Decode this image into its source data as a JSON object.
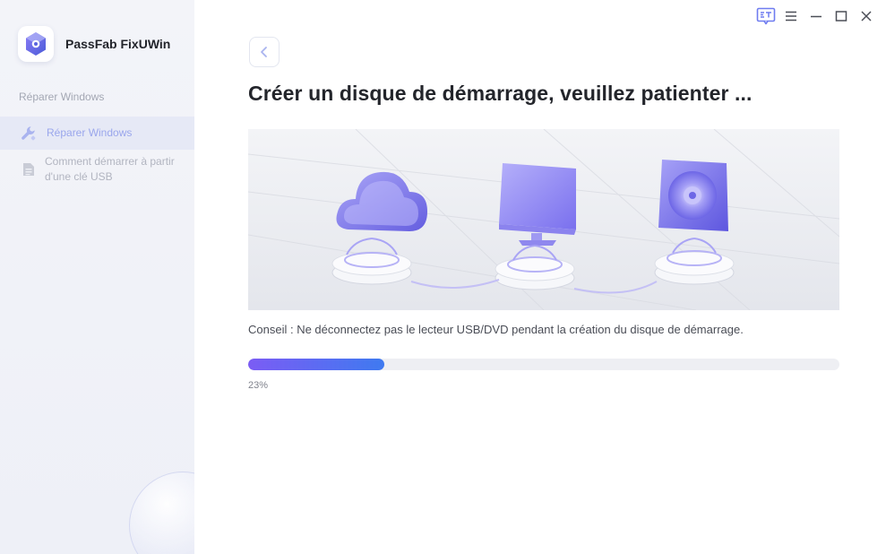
{
  "app": {
    "name": "PassFab FixUWin"
  },
  "sidebar": {
    "section_label": "Réparer Windows",
    "items": [
      {
        "label": "Réparer Windows",
        "icon": "wrench-icon",
        "active": true
      },
      {
        "label": "Comment démarrer à partir d'une clé USB",
        "icon": "document-icon",
        "active": false
      }
    ]
  },
  "titlebar": {
    "icons": [
      "feedback-icon",
      "menu-icon",
      "minimize-icon",
      "maximize-icon",
      "close-icon"
    ]
  },
  "main": {
    "title": "Créer un disque de démarrage, veuillez patienter ...",
    "tip": "Conseil : Ne déconnectez pas le lecteur USB/DVD pendant la création du disque de démarrage.",
    "progress": {
      "value": 0.23,
      "label": "23%"
    }
  },
  "colors": {
    "accent": "#7b5cf4",
    "accent_end": "#3f7af0",
    "active_nav_text": "#9aa6ec"
  }
}
